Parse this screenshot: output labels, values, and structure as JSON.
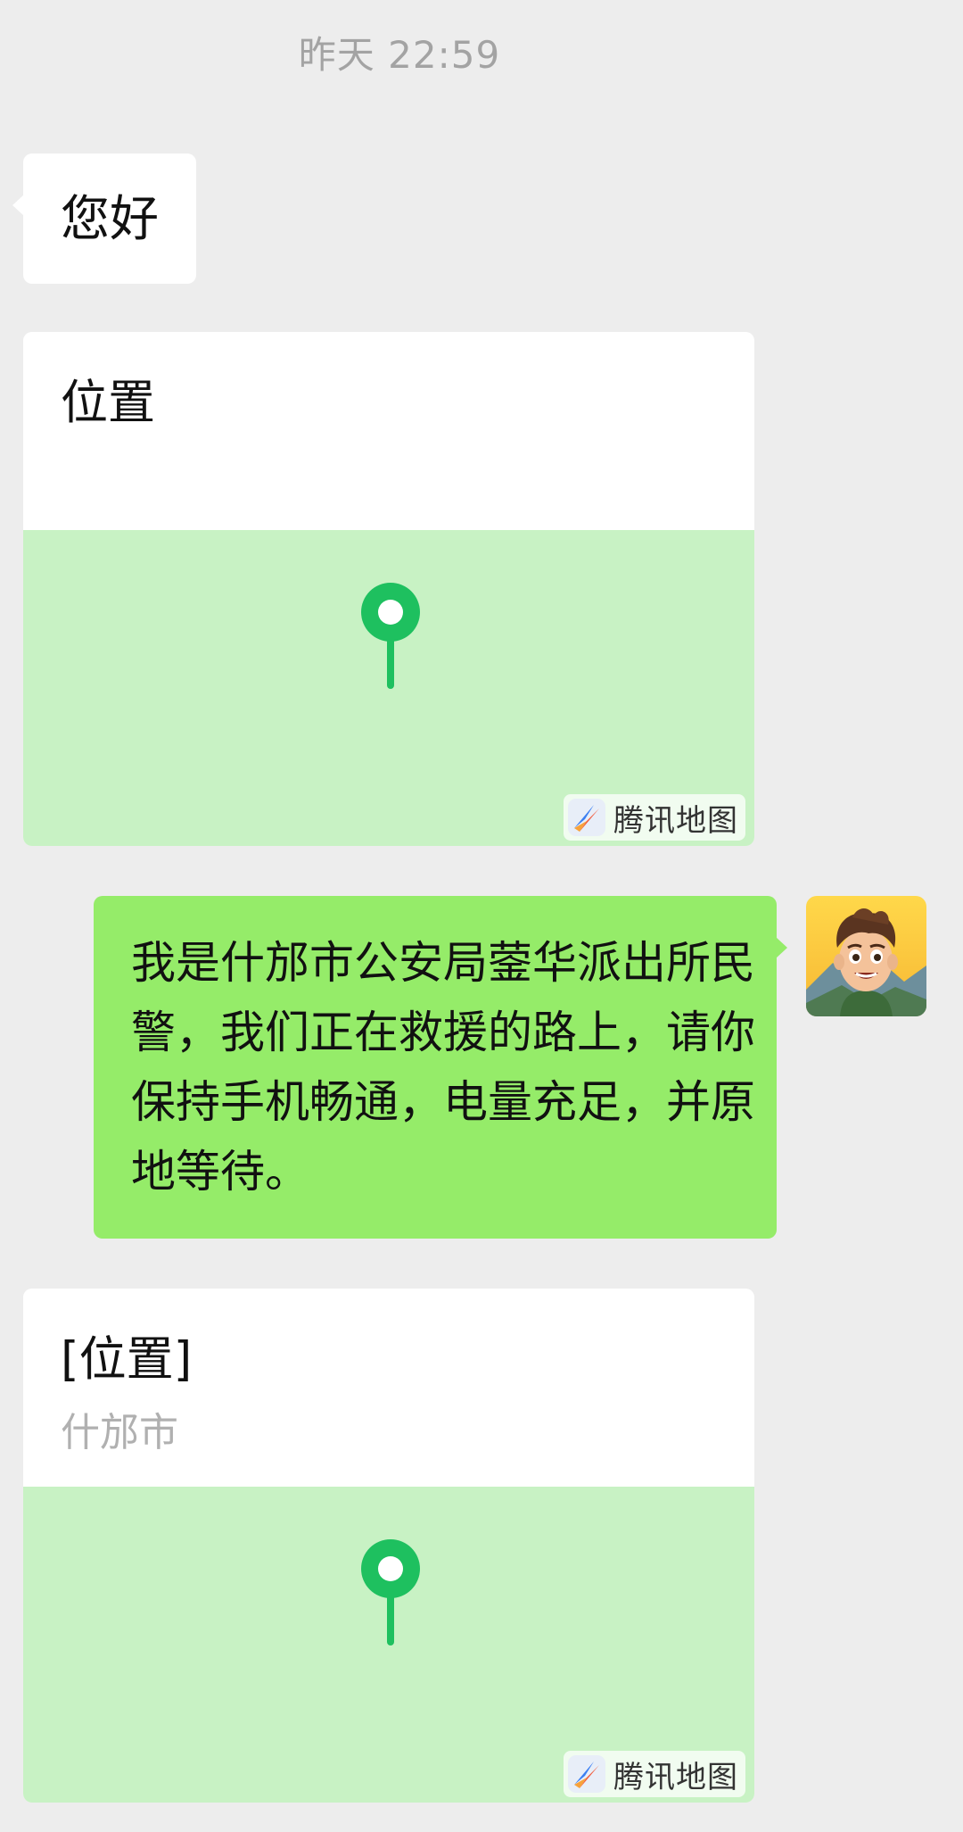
{
  "timestamp": "昨天 22:59",
  "messages": {
    "hello": {
      "text": "您好"
    },
    "location_1": {
      "title": "位置",
      "map_brand": "腾讯地图",
      "pin_icon": "location-pin-icon",
      "brand_icon": "tencent-map-logo-icon"
    },
    "police_message": {
      "text": "我是什邡市公安局蓥华派出所民警，我们正在救援的路上，请你保持手机畅通，电量充足，并原地等待。"
    },
    "location_2": {
      "title": "[位置]",
      "subtitle": "什邡市",
      "map_brand": "腾讯地图",
      "pin_icon": "location-pin-icon",
      "brand_icon": "tencent-map-logo-icon"
    }
  },
  "colors": {
    "background": "#ededed",
    "incoming_bubble": "#ffffff",
    "outgoing_bubble": "#95ec69",
    "map_area": "#c8f2c4",
    "pin": "#1ec05f",
    "timestamp_text": "#a3a3a3"
  }
}
